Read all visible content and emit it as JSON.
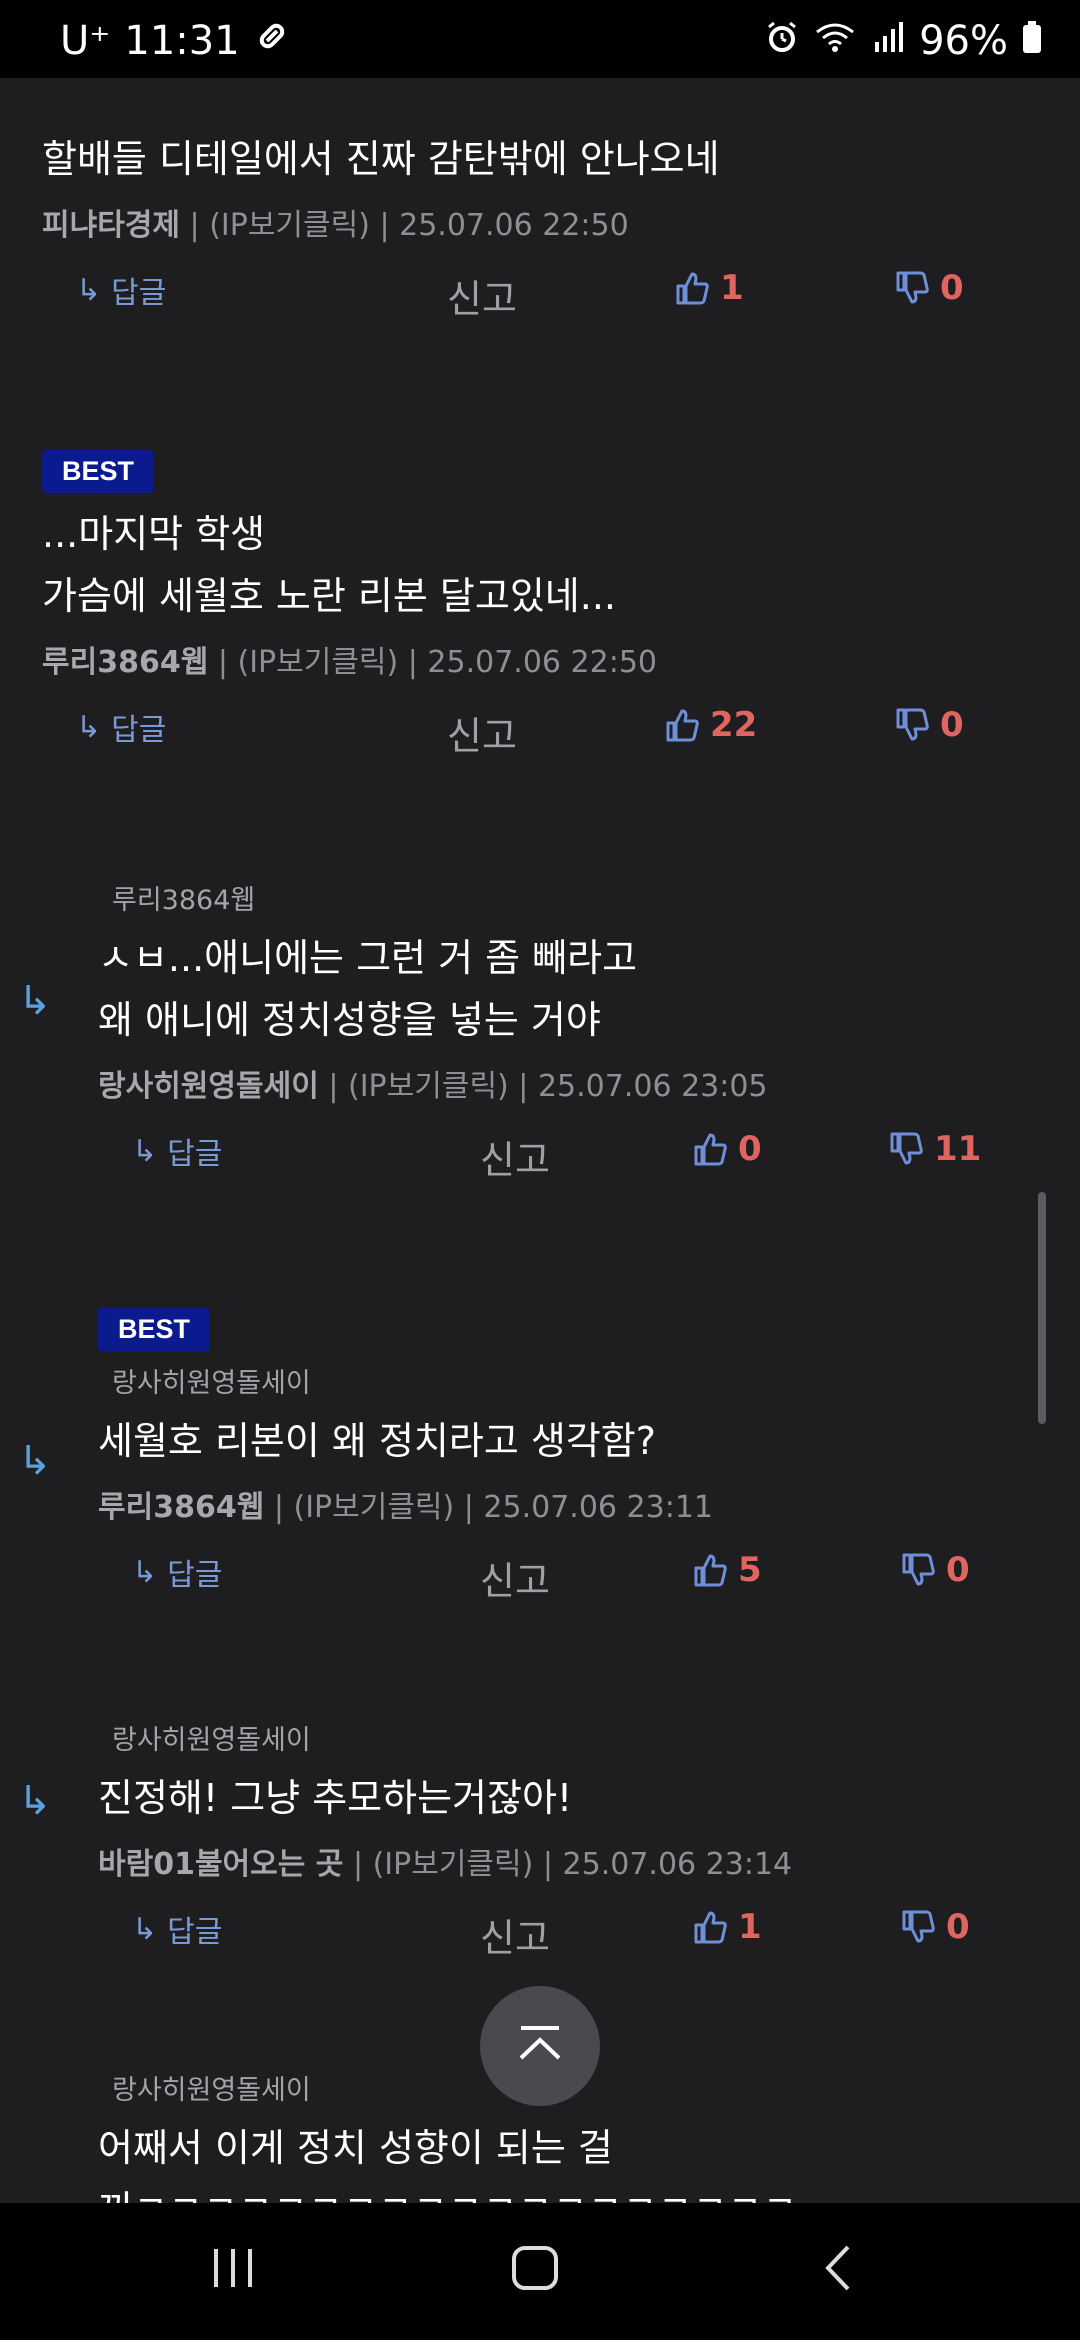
{
  "status_bar": {
    "carrier": "U⁺",
    "time": "11:31",
    "battery_percent": "96%",
    "icons": [
      "link-icon",
      "alarm-icon",
      "wifi-icon",
      "signal-icon",
      "battery-icon"
    ]
  },
  "labels": {
    "reply": "답글",
    "report": "신고",
    "best": "BEST",
    "ip": "(IP보기클릭)"
  },
  "comments": [
    {
      "text_lines": [
        "할배들 디테일에서 진짜 감탄밖에 안나오네"
      ],
      "author": "피냐타경제",
      "datetime": "25.07.06 22:50",
      "likes": "1",
      "dislikes": "0"
    },
    {
      "best": true,
      "text_lines": [
        "...마지막 학생",
        "가슴에 세월호 노란 리본 달고있네..."
      ],
      "author": "루리3864웹",
      "datetime": "25.07.06 22:50",
      "likes": "22",
      "dislikes": "0"
    },
    {
      "parent": "루리3864웹",
      "text_lines": [
        "ㅅㅂ...애니에는 그런 거 좀 빼라고",
        "왜 애니에 정치성향을 넣는 거야"
      ],
      "author": "랑사히원영돌세이",
      "datetime": "25.07.06 23:05",
      "likes": "0",
      "dislikes": "11"
    },
    {
      "best": true,
      "parent": "랑사히원영돌세이",
      "text_lines": [
        "세월호 리본이 왜 정치라고 생각함?"
      ],
      "author": "루리3864웹",
      "datetime": "25.07.06 23:11",
      "likes": "5",
      "dislikes": "0"
    },
    {
      "parent": "랑사히원영돌세이",
      "text_lines": [
        "진정해! 그냥 추모하는거잖아!"
      ],
      "author": "바람01불어오는 곳",
      "datetime": "25.07.06 23:14",
      "likes": "1",
      "dislikes": "0"
    },
    {
      "parent": "랑사히원영돌세이",
      "text_lines": [
        "어째서 이게 정치 성향이 되는 걸",
        "끼ㅋㅋㅋㅋㅋㅋㅋㅋㅋㅋㅋㅋㅋㅋㅋㅋㅋㅋㅋ"
      ]
    }
  ],
  "colors": {
    "background": "#1e1e20",
    "best_badge": "#0b1a8f",
    "count": "#e06560",
    "reply_link": "#7a9ad6",
    "reply_arrow": "#5aa2e0"
  }
}
